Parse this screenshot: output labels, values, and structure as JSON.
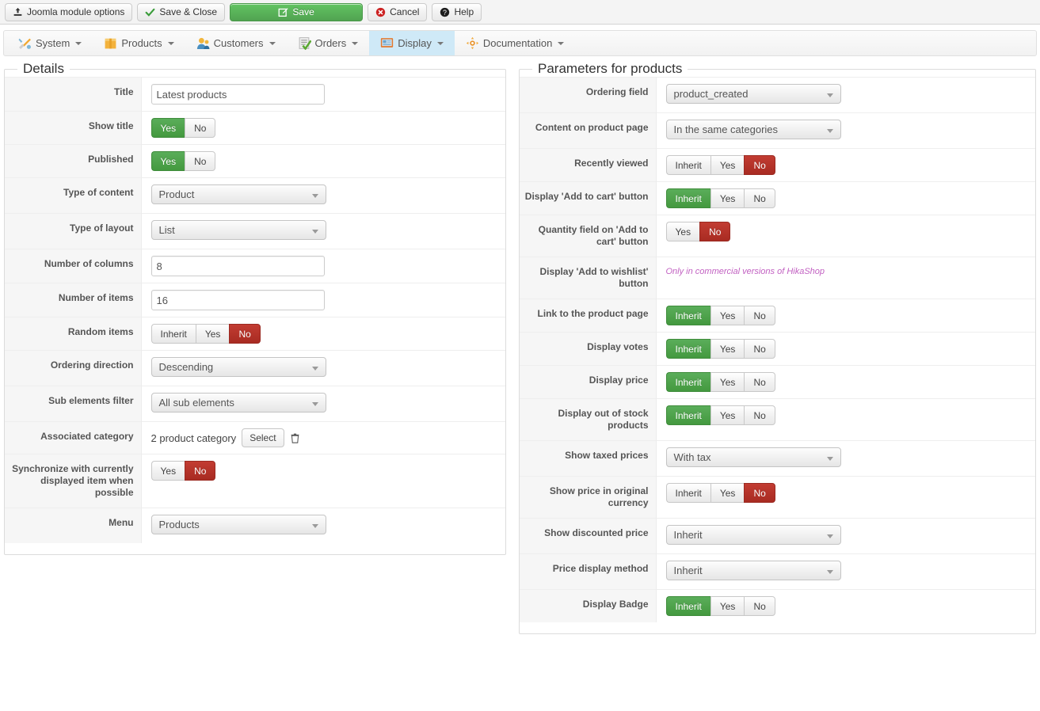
{
  "toolbar": {
    "buttons": [
      {
        "label": "Joomla module options",
        "icon": "upload-icon",
        "style": "default"
      },
      {
        "label": "Save & Close",
        "icon": "check-icon",
        "style": "default"
      },
      {
        "label": "Save",
        "icon": "pencil-square-icon",
        "style": "primary"
      },
      {
        "label": "Cancel",
        "icon": "cancel-circle-icon",
        "style": "default"
      },
      {
        "label": "Help",
        "icon": "question-circle-icon",
        "style": "default"
      }
    ],
    "primary_color": "#51a351",
    "cancel_color": "#cc2222"
  },
  "nav": {
    "items": [
      {
        "label": "System",
        "icon": "tools-icon",
        "active": false
      },
      {
        "label": "Products",
        "icon": "box-icon",
        "active": false
      },
      {
        "label": "Customers",
        "icon": "user-icon",
        "active": false
      },
      {
        "label": "Orders",
        "icon": "checklist-icon",
        "active": false
      },
      {
        "label": "Display",
        "icon": "monitor-icon",
        "active": true
      },
      {
        "label": "Documentation",
        "icon": "puzzle-icon",
        "active": false
      }
    ],
    "active_bg": "#cfe9f7"
  },
  "details": {
    "legend": "Details",
    "rows": [
      {
        "label": "Title",
        "type": "text",
        "value": "Latest products"
      },
      {
        "label": "Show title",
        "type": "group",
        "options": [
          "Yes",
          "No"
        ],
        "selected": "Yes",
        "selected_color": "green"
      },
      {
        "label": "Published",
        "type": "group",
        "options": [
          "Yes",
          "No"
        ],
        "selected": "Yes",
        "selected_color": "green"
      },
      {
        "label": "Type of content",
        "type": "select",
        "value": "Product"
      },
      {
        "label": "Type of layout",
        "type": "select",
        "value": "List"
      },
      {
        "label": "Number of columns",
        "type": "text",
        "value": "8"
      },
      {
        "label": "Number of items",
        "type": "text",
        "value": "16"
      },
      {
        "label": "Random items",
        "type": "group",
        "options": [
          "Inherit",
          "Yes",
          "No"
        ],
        "selected": "No",
        "selected_color": "red"
      },
      {
        "label": "Ordering direction",
        "type": "select",
        "value": "Descending"
      },
      {
        "label": "Sub elements filter",
        "type": "select",
        "value": "All sub elements"
      },
      {
        "label": "Associated category",
        "type": "assoc",
        "value": "2 product category",
        "button": "Select",
        "delete_icon": "trash-icon"
      },
      {
        "label": "Synchronize with currently displayed item when possible",
        "type": "group",
        "options": [
          "Yes",
          "No"
        ],
        "selected": "No",
        "selected_color": "red"
      },
      {
        "label": "Menu",
        "type": "select",
        "value": "Products"
      }
    ]
  },
  "params": {
    "legend": "Parameters for products",
    "rows": [
      {
        "label": "Ordering field",
        "type": "select",
        "value": "product_created"
      },
      {
        "label": "Content on product page",
        "type": "select",
        "value": "In the same categories"
      },
      {
        "label": "Recently viewed",
        "type": "group",
        "options": [
          "Inherit",
          "Yes",
          "No"
        ],
        "selected": "No",
        "selected_color": "red"
      },
      {
        "label": "Display 'Add to cart' button",
        "type": "group",
        "options": [
          "Inherit",
          "Yes",
          "No"
        ],
        "selected": "Inherit",
        "selected_color": "green"
      },
      {
        "label": "Quantity field on 'Add to cart' button",
        "type": "group",
        "options": [
          "Yes",
          "No"
        ],
        "selected": "No",
        "selected_color": "red"
      },
      {
        "label": "Display 'Add to wishlist' button",
        "type": "note",
        "value": "Only in commercial versions of HikaShop"
      },
      {
        "label": "Link to the product page",
        "type": "group",
        "options": [
          "Inherit",
          "Yes",
          "No"
        ],
        "selected": "Inherit",
        "selected_color": "green"
      },
      {
        "label": "Display votes",
        "type": "group",
        "options": [
          "Inherit",
          "Yes",
          "No"
        ],
        "selected": "Inherit",
        "selected_color": "green"
      },
      {
        "label": "Display price",
        "type": "group",
        "options": [
          "Inherit",
          "Yes",
          "No"
        ],
        "selected": "Inherit",
        "selected_color": "green"
      },
      {
        "label": "Display out of stock products",
        "type": "group",
        "options": [
          "Inherit",
          "Yes",
          "No"
        ],
        "selected": "Inherit",
        "selected_color": "green"
      },
      {
        "label": "Show taxed prices",
        "type": "select",
        "value": "With tax"
      },
      {
        "label": "Show price in original currency",
        "type": "group",
        "options": [
          "Inherit",
          "Yes",
          "No"
        ],
        "selected": "No",
        "selected_color": "red"
      },
      {
        "label": "Show discounted price",
        "type": "select",
        "value": "Inherit"
      },
      {
        "label": "Price display method",
        "type": "select",
        "value": "Inherit"
      },
      {
        "label": "Display Badge",
        "type": "group",
        "options": [
          "Inherit",
          "Yes",
          "No"
        ],
        "selected": "Inherit",
        "selected_color": "green"
      }
    ],
    "note_color": "#c261c2"
  }
}
